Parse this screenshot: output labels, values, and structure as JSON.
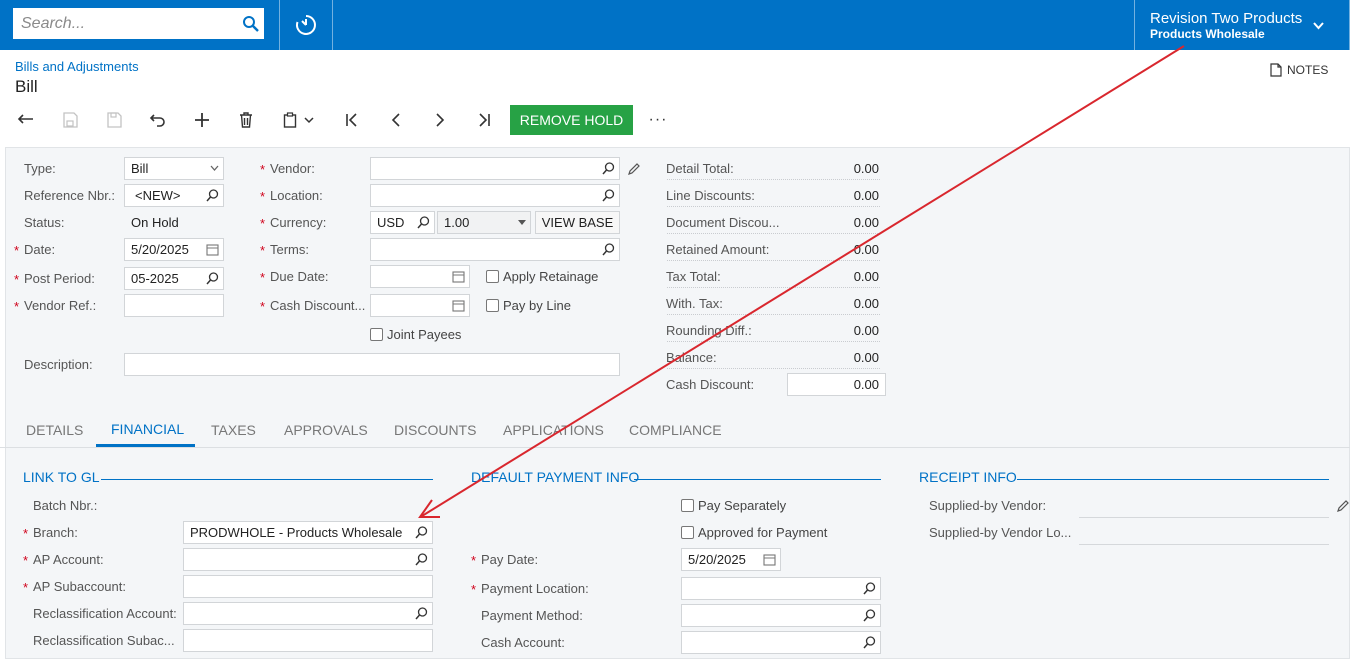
{
  "topbar": {
    "search_placeholder": "Search...",
    "tenant_name": "Revision Two Products",
    "tenant_branch": "Products Wholesale"
  },
  "header": {
    "breadcrumb": "Bills and Adjustments",
    "title": "Bill",
    "notes_label": "NOTES"
  },
  "toolbar": {
    "remove_hold_label": "REMOVE HOLD",
    "more_label": "···"
  },
  "form": {
    "type_label": "Type:",
    "type_value": "Bill",
    "refnbr_label": "Reference Nbr.:",
    "refnbr_value": "<NEW>",
    "status_label": "Status:",
    "status_value": "On Hold",
    "date_label": "Date:",
    "date_value": "5/20/2025",
    "postperiod_label": "Post Period:",
    "postperiod_value": "05-2025",
    "vendorref_label": "Vendor Ref.:",
    "description_label": "Description:",
    "vendor_label": "Vendor:",
    "location_label": "Location:",
    "currency_label": "Currency:",
    "currency_value": "USD",
    "rate_value": "1.00",
    "view_base_label": "VIEW BASE",
    "terms_label": "Terms:",
    "duedate_label": "Due Date:",
    "cashdisc_label": "Cash Discount...",
    "apply_retainage_label": "Apply Retainage",
    "pay_by_line_label": "Pay by Line",
    "joint_payees_label": "Joint Payees"
  },
  "summary": {
    "rows": [
      {
        "label": "Detail Total:",
        "value": "0.00"
      },
      {
        "label": "Line Discounts:",
        "value": "0.00"
      },
      {
        "label": "Document Discou...",
        "value": "0.00"
      },
      {
        "label": "Retained Amount:",
        "value": "0.00"
      },
      {
        "label": "Tax Total:",
        "value": "0.00"
      },
      {
        "label": "With. Tax:",
        "value": "0.00"
      },
      {
        "label": "Rounding Diff.:",
        "value": "0.00"
      },
      {
        "label": "Balance:",
        "value": "0.00"
      },
      {
        "label": "Cash Discount:",
        "value": "0.00"
      }
    ]
  },
  "tabs": [
    "DETAILS",
    "FINANCIAL",
    "TAXES",
    "APPROVALS",
    "DISCOUNTS",
    "APPLICATIONS",
    "COMPLIANCE"
  ],
  "financial": {
    "link_gl_title": "LINK TO GL",
    "batch_label": "Batch Nbr.:",
    "branch_label": "Branch:",
    "branch_value": "PRODWHOLE - Products Wholesale",
    "ap_account_label": "AP Account:",
    "ap_sub_label": "AP Subaccount:",
    "reclass_acct_label": "Reclassification Account:",
    "reclass_sub_label": "Reclassification Subac...",
    "payment_title": "DEFAULT PAYMENT INFO",
    "pay_separately_label": "Pay Separately",
    "approved_label": "Approved for Payment",
    "pay_date_label": "Pay Date:",
    "pay_date_value": "5/20/2025",
    "pay_location_label": "Payment Location:",
    "pay_method_label": "Payment Method:",
    "cash_account_label": "Cash Account:",
    "receipt_title": "RECEIPT INFO",
    "supplied_vendor_label": "Supplied-by Vendor:",
    "supplied_loc_label": "Supplied-by Vendor Lo..."
  },
  "colors": {
    "brand": "#0072c6",
    "remove_hold": "#27a245",
    "required": "#d0021b",
    "arrow": "#d9272e"
  }
}
